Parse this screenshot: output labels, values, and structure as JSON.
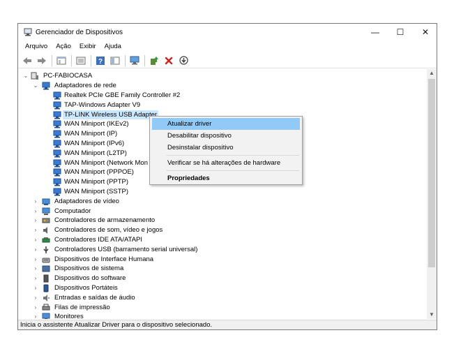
{
  "window": {
    "title": "Gerenciador de Dispositivos",
    "controls": {
      "minimize": "—",
      "maximize": "☐",
      "close": "✕"
    }
  },
  "menu": [
    "Arquivo",
    "Ação",
    "Exibir",
    "Ajuda"
  ],
  "toolbar": {
    "icons": [
      "back-arrow-icon",
      "forward-arrow-icon",
      "properties-sheet-icon",
      "update-list-icon",
      "help-icon",
      "view-panel-icon",
      "monitor-icon",
      "update-driver-icon",
      "uninstall-x-icon",
      "scan-download-icon"
    ]
  },
  "tree": {
    "root": "PC-FABIOCASA",
    "network_group": "Adaptadores de rede",
    "network_items": [
      "Realtek PCIe GBE Family Controller #2",
      "TAP-Windows Adapter V9",
      "TP-LINK Wireless USB Adapter",
      "WAN Miniport (IKEv2)",
      "WAN Miniport (IP)",
      "WAN Miniport (IPv6)",
      "WAN Miniport (L2TP)",
      "WAN Miniport (Network Mon",
      "WAN Miniport (PPPOE)",
      "WAN Miniport (PPTP)",
      "WAN Miniport (SSTP)"
    ],
    "selected_index": 2,
    "categories": [
      "Adaptadores de vídeo",
      "Computador",
      "Controladores de armazenamento",
      "Controladores de som, vídeo e jogos",
      "Controladores IDE ATA/ATAPI",
      "Controladores USB (barramento serial universal)",
      "Dispositivos de Interface Humana",
      "Dispositivos de sistema",
      "Dispositivos do software",
      "Dispositivos Portáteis",
      "Entradas e saídas de áudio",
      "Filas de impressão",
      "Monitores"
    ]
  },
  "context_menu": {
    "items": [
      "Atualizar driver",
      "Desabilitar dispositivo",
      "Desinstalar dispositivo",
      "Verificar se há alterações de hardware",
      "Propriedades"
    ]
  },
  "status": "Inicia o assistente Atualizar Driver para o dispositivo selecionado.",
  "colors": {
    "selection": "#cce8ff",
    "menu_highlight": "#91c9f7",
    "network_icon": "#3a7bd5"
  }
}
